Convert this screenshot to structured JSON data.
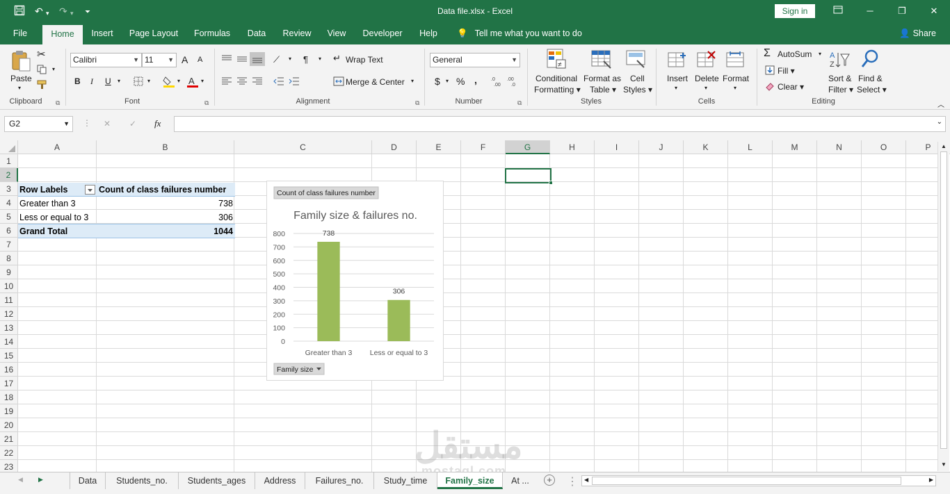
{
  "titlebar": {
    "title": "Data file.xlsx  -  Excel",
    "signin": "Sign in"
  },
  "tabs": [
    "File",
    "Home",
    "Insert",
    "Page Layout",
    "Formulas",
    "Data",
    "Review",
    "View",
    "Developer",
    "Help"
  ],
  "active_tab": "Home",
  "tellme": "Tell me what you want to do",
  "share": "Share",
  "ribbon": {
    "clipboard": {
      "paste": "Paste",
      "label": "Clipboard"
    },
    "font": {
      "name": "Calibri",
      "size": "11",
      "bold": "B",
      "italic": "I",
      "underline": "U",
      "grow": "A",
      "shrink": "A",
      "fontcolor": "A",
      "label": "Font"
    },
    "alignment": {
      "wrap": "Wrap Text",
      "merge": "Merge & Center",
      "label": "Alignment"
    },
    "number": {
      "format": "General",
      "currency": "$",
      "percent": "%",
      "comma": ",",
      "label": "Number"
    },
    "styles": {
      "conditional1": "Conditional",
      "conditional2": "Formatting",
      "format_table1": "Format as",
      "format_table2": "Table",
      "cell_styles1": "Cell",
      "cell_styles2": "Styles",
      "label": "Styles"
    },
    "cells": {
      "insert": "Insert",
      "delete": "Delete",
      "format": "Format",
      "label": "Cells"
    },
    "editing": {
      "autosum": "AutoSum",
      "fill": "Fill",
      "clear": "Clear",
      "sort1": "Sort &",
      "sort2": "Filter",
      "find1": "Find &",
      "find2": "Select",
      "label": "Editing"
    }
  },
  "formula_bar": {
    "name_box": "G2",
    "fx": "fx",
    "cancel": "✕",
    "enter": "✓",
    "value": ""
  },
  "columns": [
    "A",
    "B",
    "C",
    "D",
    "E",
    "F",
    "G",
    "H",
    "I",
    "J",
    "K",
    "L",
    "M",
    "N",
    "O",
    "P"
  ],
  "rows": [
    "1",
    "2",
    "3",
    "4",
    "5",
    "6",
    "7",
    "8",
    "9",
    "10",
    "11",
    "12",
    "13",
    "14",
    "15",
    "16",
    "17",
    "18",
    "19",
    "20",
    "21",
    "22",
    "23"
  ],
  "selected_cell": "G2",
  "pivot": {
    "header_labels": "Row Labels",
    "header_count": "Count of class failures number",
    "rows": [
      {
        "label": "Greater than 3",
        "value": "738"
      },
      {
        "label": "Less or equal to 3",
        "value": "306"
      }
    ],
    "total_label": "Grand Total",
    "total_value": "1044"
  },
  "chart_data": {
    "type": "bar",
    "field_button": "Count of class failures number",
    "title": "Family size & failures no.",
    "categories": [
      "Greater than 3",
      "Less or equal to 3"
    ],
    "values": [
      738,
      306
    ],
    "yticks": [
      "0",
      "100",
      "200",
      "300",
      "400",
      "500",
      "600",
      "700",
      "800"
    ],
    "ylim": [
      0,
      800
    ],
    "axis_button": "Family size",
    "bar_color": "#9bbb59",
    "grid": true
  },
  "sheets": [
    "Data",
    "Students_no.",
    "Students_ages",
    "Address",
    "Failures_no.",
    "Study_time",
    "Family_size",
    "At ..."
  ],
  "active_sheet": "Family_size",
  "watermark": {
    "text": "مستقل",
    "sub": "mostaql.com"
  },
  "colors": {
    "accent": "#217346",
    "pivot_header": "#ddebf7"
  }
}
